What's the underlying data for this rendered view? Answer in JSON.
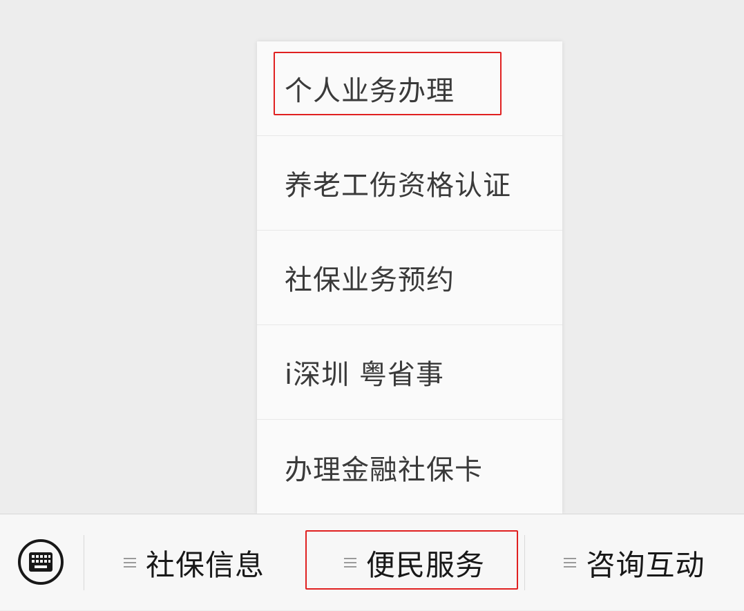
{
  "submenu": {
    "items": [
      {
        "label": "个人业务办理"
      },
      {
        "label": "养老工伤资格认证"
      },
      {
        "label": "社保业务预约"
      },
      {
        "label": "i深圳 粤省事"
      },
      {
        "label": "办理金融社保卡"
      }
    ]
  },
  "bottom_bar": {
    "keyboard_icon": "keyboard-icon",
    "tabs": [
      {
        "label": "社保信息"
      },
      {
        "label": "便民服务"
      },
      {
        "label": "咨询互动"
      }
    ]
  },
  "colors": {
    "highlight": "#e02020",
    "background": "#ededed",
    "menu_background": "#fafafa",
    "text": "#3a3a3a"
  }
}
